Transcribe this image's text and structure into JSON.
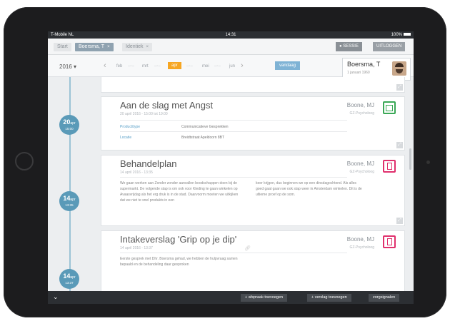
{
  "status_bar": {
    "carrier": "T-Mobile NL",
    "time": "14:31",
    "battery": "100%"
  },
  "tabs": [
    {
      "label": "Start",
      "active": false,
      "closable": false
    },
    {
      "label": "Boersma, T",
      "active": true,
      "closable": true
    },
    {
      "label": "Identiek",
      "active": false,
      "closable": true
    }
  ],
  "session": {
    "sessie": "SESSIE",
    "uitloggen": "UITLOGGEN"
  },
  "date_nav": {
    "year": "2016",
    "months": [
      "feb",
      "mrt",
      "apr",
      "mei",
      "jun"
    ],
    "selected_month": "apr",
    "today_label": "vandaag"
  },
  "patient": {
    "name": "Boersma, T",
    "dob": "1 januari 1960"
  },
  "timeline": [
    {
      "day": "20",
      "month": "apr",
      "time": "15:00"
    },
    {
      "day": "14",
      "month": "apr",
      "time": "13:35"
    },
    {
      "day": "14",
      "month": "apr",
      "time": "13:37"
    }
  ],
  "cards": [
    {
      "title": "Aan de slag met Angst",
      "date": "20 april 2016 - 15:00 tot 19:00",
      "author": "Boone, MJ",
      "role": "GZ-Psycholoog",
      "icon": "calendar-icon",
      "color": "#3aa856",
      "fields": [
        {
          "key": "Productttype",
          "value": "Communicatieve Gesprekken"
        },
        {
          "key": "Locatie",
          "value": "Breidtstraat Apeldoorn 8BT"
        }
      ]
    },
    {
      "title": "Behandelplan",
      "date": "14 april 2016 - 13:35",
      "author": "Boone, MJ",
      "role": "GZ-Psycholoog",
      "icon": "document-icon",
      "color": "#e0306d",
      "text_left": "We gaan werken aan Zonder zonder aanvallen boodschappen doen bij de supermarkt. De volgende stap is om ook voor Kleding te gaan winkelen op Avaasvrijdag als het erg druk is in de stad. Daarvoorm moeten we uitkijken dat we niet te snel produkts in een",
      "text_right": "keer krijgen, dus beginnen we op een dinsdagochtend. Als alles goed gaat gaan we ook stap weer in Amsterdam winkelen. Dit is de ultieme proef op de som."
    },
    {
      "title": "Intakeverslag 'Grip op je dip'",
      "date": "14 april 2016 - 13:37",
      "author": "Boone, MJ",
      "role": "GZ-Psycholoog",
      "icon": "document-icon",
      "color": "#e0306d",
      "text_left": "Eerste gesprek met Dhr. Boersma gehad, we hebben de hulpvraag samen bepaald en de behandeling daar gesproken"
    }
  ],
  "bottom_bar": {
    "afspraak": "afspraak toevoegen",
    "verslag": "verslag toevoegen",
    "zorgsignalen": "zorgsignalen"
  }
}
